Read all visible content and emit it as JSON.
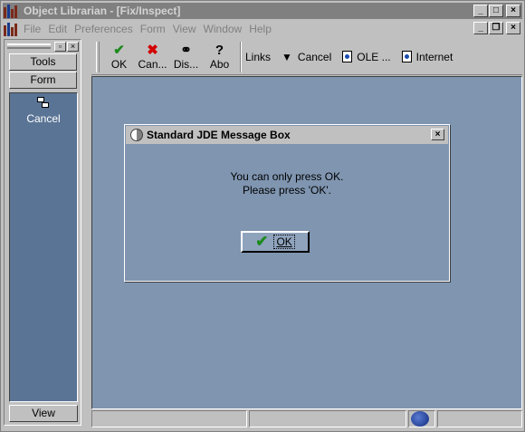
{
  "window": {
    "title": "Object Librarian - [Fix/Inspect]",
    "controls": [
      "_",
      "□",
      "×"
    ],
    "mdi_controls": [
      "_",
      "❐",
      "×"
    ]
  },
  "menu": {
    "items": [
      {
        "label": "File"
      },
      {
        "label": "Edit"
      },
      {
        "label": "Preferences"
      },
      {
        "label": "Form"
      },
      {
        "label": "View"
      },
      {
        "label": "Window"
      },
      {
        "label": "Help"
      }
    ]
  },
  "left_panel": {
    "tabs": [
      "Tools",
      "Form"
    ],
    "actions": [
      {
        "label": "Cancel",
        "icon": "cancel-form-icon"
      }
    ],
    "view_label": "View"
  },
  "toolbar": {
    "buttons": [
      {
        "label": "OK",
        "icon": "check-icon",
        "glyph": "✔",
        "color": "#1d8a1d"
      },
      {
        "label": "Can...",
        "icon": "cancel-x-icon",
        "glyph": "✖",
        "color": "#d40000"
      },
      {
        "label": "Dis...",
        "icon": "display-errors-icon",
        "glyph": "⚭",
        "color": "#000000"
      },
      {
        "label": "Abo",
        "icon": "about-help-icon",
        "glyph": "?",
        "color": "#000000"
      }
    ],
    "links_label": "Links",
    "links": [
      {
        "label": "Cancel",
        "icon": "down-arrow-icon"
      },
      {
        "label": "OLE ...",
        "icon": "document-icon"
      },
      {
        "label": "Internet",
        "icon": "document-icon"
      }
    ]
  },
  "dialog": {
    "title": "Standard JDE Message Box",
    "message_line1": "You can only press OK.",
    "message_line2": "Please press 'OK'.",
    "ok_label": "OK"
  },
  "colors": {
    "client_bg": "#7f95b0",
    "panel_bg": "#5a7495",
    "chrome": "#c0c0c0"
  }
}
